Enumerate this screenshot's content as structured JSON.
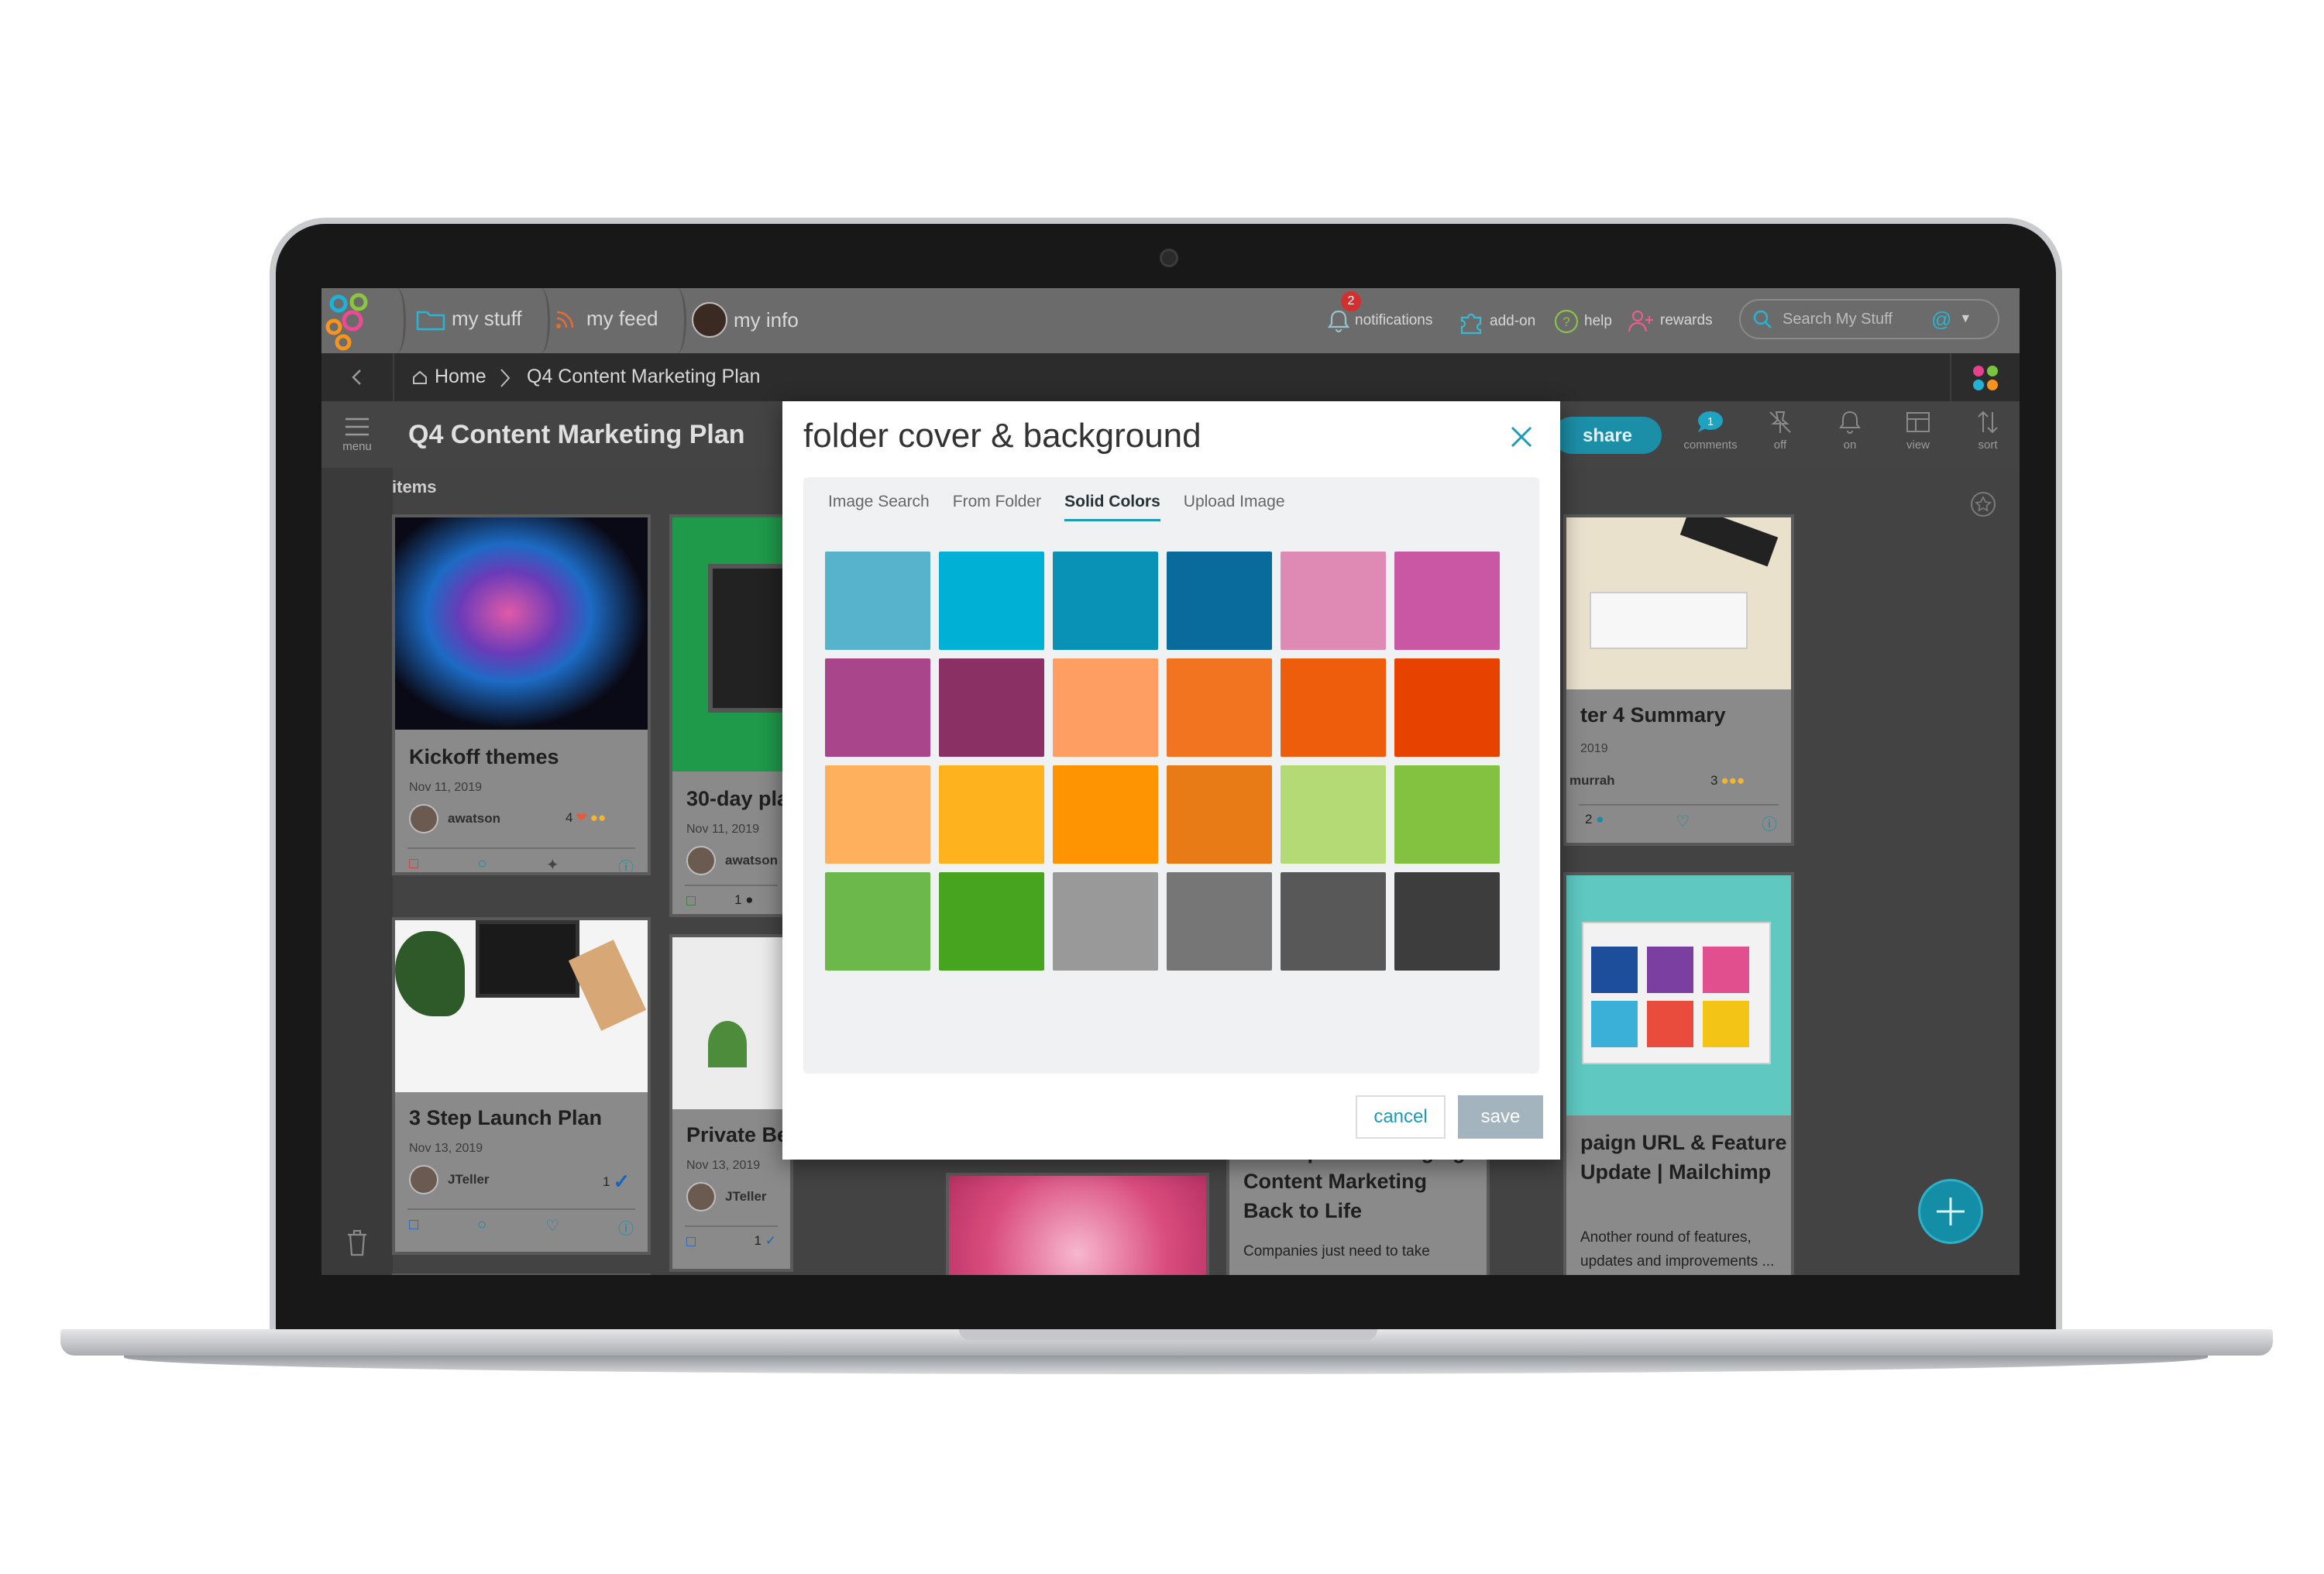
{
  "topbar": {
    "my_stuff": "my stuff",
    "my_feed": "my feed",
    "my_info": "my info",
    "notifications": "notifications",
    "notification_count": "2",
    "addon": "add-on",
    "help": "help",
    "rewards": "rewards",
    "search_placeholder": "Search My Stuff"
  },
  "breadcrumb": {
    "home": "Home",
    "current": "Q4 Content Marketing Plan"
  },
  "titlebar": {
    "menu": "menu",
    "title": "Q4 Content Marketing Plan",
    "share": "share",
    "comments": "comments",
    "comments_count": "1",
    "off": "off",
    "on": "on",
    "view": "view",
    "sort": "sort"
  },
  "items_label": "items",
  "cards": [
    {
      "title": "Kickoff themes",
      "date": "Nov 11, 2019",
      "user": "awatson",
      "count": "4"
    },
    {
      "title": "30-day pla",
      "date": "Nov 11, 2019",
      "user": "awatson",
      "count": "1"
    },
    {
      "title": "3 Step Launch Plan",
      "date": "Nov 13, 2019",
      "user": "JTeller",
      "count": "1"
    },
    {
      "title": "Private Be",
      "date": "Nov 13, 2019",
      "user": "JTeller",
      "count": "1"
    },
    {
      "title": "3 Companies Bringing Content Marketing Back to Life",
      "desc": "Companies just need to take"
    },
    {
      "title": "ter 4 Summary",
      "date": "2019",
      "user": "murrah",
      "count": "3",
      "comments": "2"
    },
    {
      "title": "paign URL & Feature Update | Mailchimp",
      "desc": "Another round of features, updates and improvements ..."
    }
  ],
  "dialog": {
    "title": "folder cover & background",
    "tabs": [
      "Image Search",
      "From Folder",
      "Solid Colors",
      "Upload Image"
    ],
    "active_tab": "Solid Colors",
    "colors": [
      "#56b3cb",
      "#00b0d5",
      "#0a92b6",
      "#096b9c",
      "#de8ab5",
      "#c957a3",
      "#a9468b",
      "#8a3065",
      "#fe9e62",
      "#f27420",
      "#ee5d0b",
      "#e84201",
      "#feb05d",
      "#feb21e",
      "#fe9402",
      "#e97b17",
      "#b3da74",
      "#83c241",
      "#6cb84a",
      "#47a41f",
      "#999999",
      "#767676",
      "#585858",
      "#3d3d3d"
    ],
    "cancel": "cancel",
    "save": "save"
  }
}
